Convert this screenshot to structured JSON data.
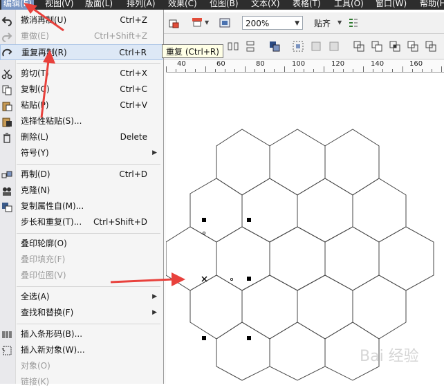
{
  "menubar": {
    "items": [
      {
        "label": "编辑(E)",
        "active": true
      },
      {
        "label": "视图(V)"
      },
      {
        "label": "版面(L)"
      },
      {
        "label": "排列(A)"
      },
      {
        "label": "效果(C)"
      },
      {
        "label": "位图(B)"
      },
      {
        "label": "文本(X)"
      },
      {
        "label": "表格(T)"
      },
      {
        "label": "工具(O)"
      },
      {
        "label": "窗口(W)"
      },
      {
        "label": "帮助(H)"
      }
    ]
  },
  "toolbar": {
    "zoom": "200%",
    "snap": "贴齐",
    "tooltip": "重复 (Ctrl+R)"
  },
  "ruler": {
    "labels": [
      "40",
      "60",
      "80",
      "100",
      "120",
      "140",
      "160"
    ]
  },
  "edit_menu": {
    "items": [
      {
        "label": "撤消再制(U)",
        "shortcut": "Ctrl+Z",
        "icon": "undo-icon"
      },
      {
        "label": "重做(E)",
        "shortcut": "Ctrl+Shift+Z",
        "icon": "redo-icon",
        "disabled": true
      },
      {
        "label": "重复再制(R)",
        "shortcut": "Ctrl+R",
        "icon": "repeat-icon",
        "highlighted": true
      },
      {
        "label": "剪切(T)",
        "shortcut": "Ctrl+X",
        "icon": "scissors-icon"
      },
      {
        "label": "复制(C)",
        "shortcut": "Ctrl+C",
        "icon": "copy-icon"
      },
      {
        "label": "粘贴(P)",
        "shortcut": "Ctrl+V",
        "icon": "paste-icon"
      },
      {
        "label": "选择性粘贴(S)...",
        "shortcut": "",
        "icon": "paste-special-icon"
      },
      {
        "label": "删除(L)",
        "shortcut": "Delete",
        "icon": "trash-icon"
      },
      {
        "label": "符号(Y)",
        "shortcut": "",
        "submenu": true
      },
      {
        "label": "再制(D)",
        "shortcut": "Ctrl+D",
        "icon": "duplicate-icon"
      },
      {
        "label": "克隆(N)",
        "shortcut": "",
        "icon": "clone-icon"
      },
      {
        "label": "复制属性自(M)...",
        "shortcut": "",
        "icon": "copy-properties-icon"
      },
      {
        "label": "步长和重复(T)...",
        "shortcut": "Ctrl+Shift+D"
      },
      {
        "label": "叠印轮廓(O)",
        "shortcut": ""
      },
      {
        "label": "叠印填充(F)",
        "shortcut": "",
        "disabled": true
      },
      {
        "label": "叠印位图(V)",
        "shortcut": "",
        "disabled": true
      },
      {
        "label": "全选(A)",
        "shortcut": "",
        "submenu": true
      },
      {
        "label": "查找和替换(F)",
        "shortcut": "",
        "submenu": true
      },
      {
        "label": "插入条形码(B)...",
        "shortcut": "",
        "icon": "barcode-icon"
      },
      {
        "label": "插入新对象(W)...",
        "shortcut": "",
        "icon": "insert-object-icon"
      },
      {
        "label": "对象(O)",
        "shortcut": "",
        "disabled": true
      },
      {
        "label": "链接(K)",
        "shortcut": "",
        "disabled": true
      }
    ]
  },
  "watermark": "Bai 经验",
  "colors": {
    "menubar": "#2d2d2d",
    "highlight": "#dde8f6",
    "arrow": "#e8413c"
  }
}
